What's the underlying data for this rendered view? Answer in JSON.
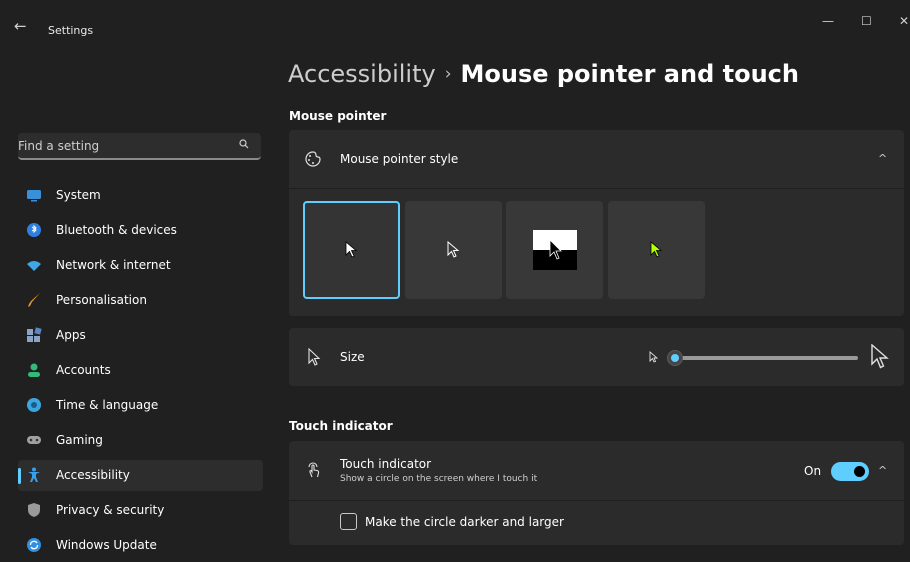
{
  "window": {
    "title": "Settings",
    "back_icon": "back-arrow-icon",
    "minimize": "—",
    "maximize": "☐",
    "close": "✕"
  },
  "search": {
    "placeholder": "Find a setting",
    "icon": "search-icon"
  },
  "sidebar": {
    "items": [
      {
        "label": "System",
        "icon": "monitor-icon",
        "color": "#3a8fd9"
      },
      {
        "label": "Bluetooth & devices",
        "icon": "bluetooth-icon",
        "color": "#2f7fe0"
      },
      {
        "label": "Network & internet",
        "icon": "wifi-icon",
        "color": "#3fa7e8"
      },
      {
        "label": "Personalisation",
        "icon": "brush-icon",
        "color": "#e09a3a"
      },
      {
        "label": "Apps",
        "icon": "apps-icon",
        "color": "#8aa4c6"
      },
      {
        "label": "Accounts",
        "icon": "person-icon",
        "color": "#35b978"
      },
      {
        "label": "Time & language",
        "icon": "globe-clock-icon",
        "color": "#3aa6e0"
      },
      {
        "label": "Gaming",
        "icon": "gamepad-icon",
        "color": "#a0a0a0"
      },
      {
        "label": "Accessibility",
        "icon": "accessibility-icon",
        "color": "#3a9ee8",
        "active": true
      },
      {
        "label": "Privacy & security",
        "icon": "shield-icon",
        "color": "#9a9a9a"
      },
      {
        "label": "Windows Update",
        "icon": "update-icon",
        "color": "#2f8fe0"
      }
    ]
  },
  "breadcrumb": {
    "parent": "Accessibility",
    "separator": "›",
    "current": "Mouse pointer and touch"
  },
  "sections": {
    "mouse_pointer": "Mouse pointer",
    "touch_indicator": "Touch indicator"
  },
  "pointer_style": {
    "label": "Mouse pointer style",
    "icon": "pointer-style-icon",
    "chevron": "^",
    "options": [
      {
        "name": "white",
        "selected": true
      },
      {
        "name": "black",
        "selected": false
      },
      {
        "name": "inverted",
        "selected": false
      },
      {
        "name": "custom",
        "selected": false,
        "color": "#b4ff00"
      }
    ]
  },
  "size": {
    "label": "Size",
    "icon": "cursor-icon",
    "value_fraction": 0.0
  },
  "touch": {
    "title": "Touch indicator",
    "subtitle": "Show a circle on the screen where I touch it",
    "icon": "touch-icon",
    "toggle_text": "On",
    "toggle_on": true,
    "chevron": "^",
    "darker_label": "Make the circle darker and larger",
    "darker_checked": false
  },
  "colors": {
    "accent": "#60cdff",
    "background": "#202020",
    "card": "#2b2b2b"
  }
}
